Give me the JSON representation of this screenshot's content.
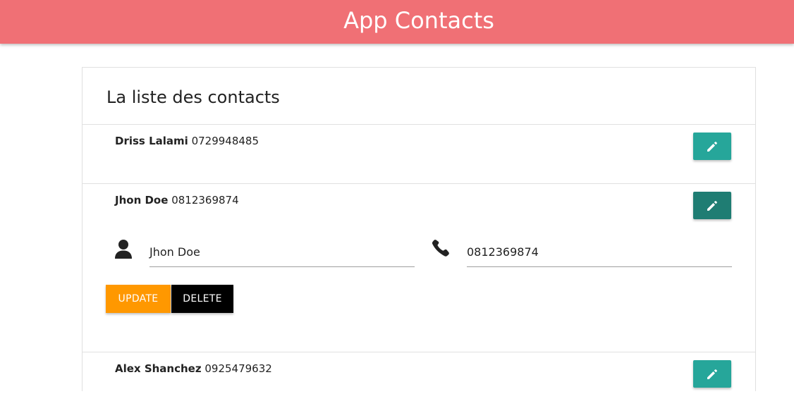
{
  "header": {
    "title": "App Contacts"
  },
  "card": {
    "title": "La liste des contacts"
  },
  "contacts": [
    {
      "name": "Driss Lalami",
      "phone": "0729948485"
    },
    {
      "name": "Jhon Doe",
      "phone": "0812369874"
    },
    {
      "name": "Alex Shanchez",
      "phone": "0925479632"
    }
  ],
  "edit_form": {
    "name_value": "Jhon Doe",
    "phone_value": "0812369874",
    "update_label": "UPDATE",
    "delete_label": "DELETE"
  },
  "colors": {
    "header": "#f07075",
    "edit_button": "#26a69a",
    "edit_button_active": "#1f7d73",
    "update_button": "#ff9800",
    "delete_button": "#000000"
  },
  "icons": [
    "pencil-icon",
    "person-icon",
    "phone-icon"
  ]
}
